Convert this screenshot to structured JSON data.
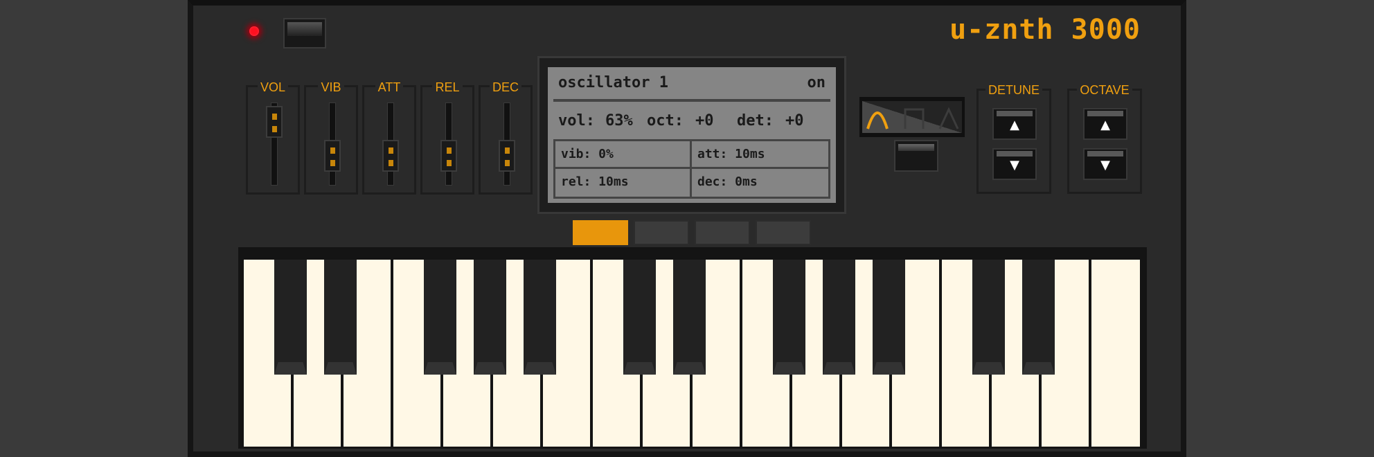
{
  "brand": {
    "name": "u-znth 3000"
  },
  "colors": {
    "accent": "#f0a010",
    "led": "#ff1020",
    "screen": "#858585",
    "white_key": "#fff8e6"
  },
  "sliders": [
    {
      "id": "vol",
      "label": "VOL",
      "level": 0.63
    },
    {
      "id": "vib",
      "label": "VIB",
      "level": 0.0
    },
    {
      "id": "att",
      "label": "ATT",
      "level": 0.0
    },
    {
      "id": "rel",
      "label": "REL",
      "level": 0.0
    },
    {
      "id": "dec",
      "label": "DEC",
      "level": 0.0
    }
  ],
  "screen": {
    "title": "oscillator 1",
    "state": "on",
    "vol_label": "vol:",
    "vol_value": "63%",
    "oct_label": "oct:",
    "oct_value": "+0",
    "det_label": "det:",
    "det_value": "+0",
    "vib": "vib: 0%",
    "att": "att: 10ms",
    "rel": "rel: 10ms",
    "dec": "dec: 0ms"
  },
  "waveforms": {
    "options": [
      "sine-wave-icon",
      "square-wave-icon",
      "triangle-wave-icon"
    ],
    "selected": "sine"
  },
  "detune": {
    "label": "DETUNE",
    "up": "▲",
    "down": "▼"
  },
  "octave": {
    "label": "OCTAVE",
    "up": "▲",
    "down": "▼"
  },
  "oscillator_tabs": {
    "count": 4,
    "active": 1
  },
  "keyboard": {
    "white_keys": 18,
    "black_keys": 12
  }
}
